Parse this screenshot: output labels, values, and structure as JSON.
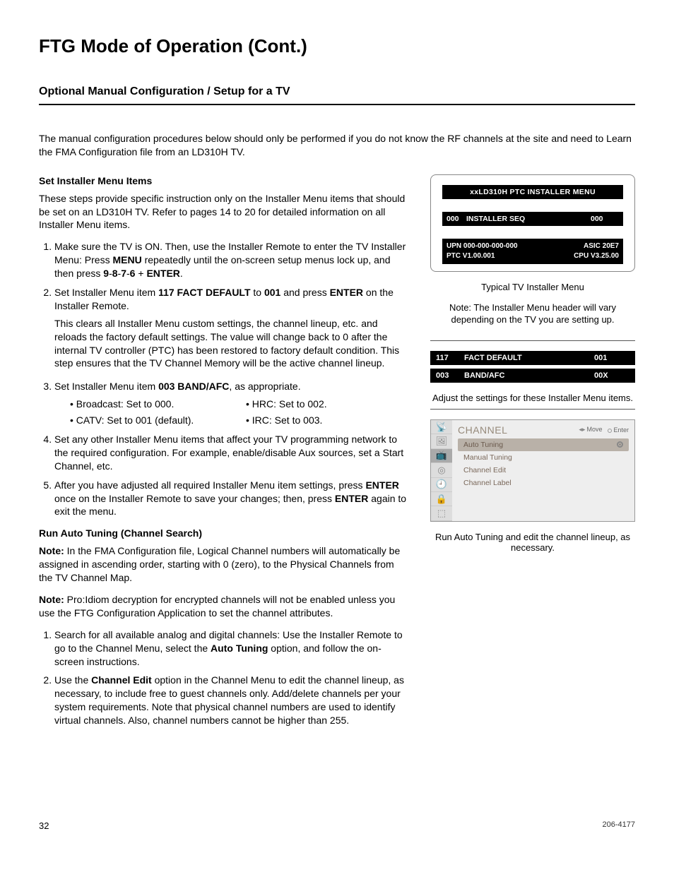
{
  "title": "FTG Mode of Operation (Cont.)",
  "section": "Optional Manual Configuration / Setup for a TV",
  "intro": "The manual configuration procedures below should only be performed if you do not know the RF channels at the site and need to Learn the FMA Configuration file from an LD310H TV.",
  "set_head": "Set Installer Menu Items",
  "set_para": "These steps provide speciﬁc instruction only on the Installer Menu items that should be set on an LD310H TV. Refer to pages 14 to 20 for detailed information on all Installer Menu items.",
  "steps1": {
    "s1a": "Make sure the TV is ON. Then, use the Installer Remote to enter the TV Installer Menu: Press ",
    "s1b": "MENU",
    "s1c": " repeatedly until the on-screen setup menus lock up, and then press ",
    "s1d": "9",
    "dash": "-",
    "s1e": "8",
    "s1f": "7",
    "s1g": "6",
    "plus": " + ",
    "s1h": "ENTER",
    "s1i": ".",
    "s2a": "Set Installer Menu item ",
    "s2b": "117 FACT DEFAULT",
    "s2c": " to ",
    "s2d": "001",
    "s2e": " and press ",
    "s2f": "ENTER",
    "s2g": " on the Installer Remote.",
    "s2p": "This clears all Installer Menu custom settings, the channel lineup, etc. and reloads the factory default settings. The value will change back to 0 after the internal TV controller (PTC) has been restored to factory default condition. This step ensures that the TV Channel Memory will be the active channel lineup.",
    "s3a": "Set Installer Menu item ",
    "s3b": "003 BAND/AFC",
    "s3c": ", as appropriate.",
    "band": {
      "b1": "Broadcast: Set to 000.",
      "b2": "HRC: Set to 002.",
      "b3": "CATV: Set to 001 (default).",
      "b4": "IRC: Set to 003."
    },
    "s4": "Set any other Installer Menu items that affect your TV programming network to the required conﬁguration. For example, enable/disable Aux sources, set a Start Channel, etc.",
    "s5a": "After you have adjusted all required Installer Menu item settings, press ",
    "s5b": "ENTER",
    "s5c": " once on the Installer Remote to save your changes; then, press ",
    "s5d": "ENTER",
    "s5e": " again to exit the menu."
  },
  "run_head": "Run Auto Tuning (Channel Search)",
  "run_n1a": "Note:",
  "run_n1b": " In the FMA Conﬁguration ﬁle, Logical Channel numbers will automatically be assigned in ascending order, starting with 0 (zero), to the Physical Channels from the TV Channel Map.",
  "run_n2a": "Note:",
  "run_n2b": " Pro:Idiom decryption for encrypted channels will not be enabled unless you use the FTG Conﬁguration Application to set the channel attributes.",
  "steps2": {
    "s1a": "Search for all available analog and digital channels: Use the Installer Remote to go to the Channel Menu, select the ",
    "s1b": "Auto Tuning",
    "s1c": " option, and follow the on-screen instructions.",
    "s2a": "Use the ",
    "s2b": "Channel Edit",
    "s2c": " option in the Channel Menu to edit the channel lineup, as necessary, to include free to guest channels only. Add/delete channels per your system requirements. Note that physical channel numbers are used to identify virtual channels. Also, channel numbers cannot be higher than 255."
  },
  "panel": {
    "hdr": "xxLD310H  PTC  INSTALLER  MENU",
    "row_code": "000",
    "row_label": "INSTALLER SEQ",
    "row_val": "000",
    "upn": "UPN  000-000-000-000",
    "ptc": "PTC  V1.00.001",
    "asic": "ASIC  20E7",
    "cpu": "CPU  V3.25.00"
  },
  "cap1": "Typical TV Installer Menu",
  "note_r": "Note: The Installer Menu header will vary depending on the TV you are setting up.",
  "bars": {
    "b1c": "117",
    "b1l": "FACT DEFAULT",
    "b1v": "001",
    "b2c": "003",
    "b2l": "BAND/AFC",
    "b2v": "00X"
  },
  "cap2": "Adjust the settings for these Installer Menu items.",
  "ch": {
    "title": "CHANNEL",
    "move": "Move",
    "enter": "Enter",
    "items": [
      "Auto Tuning",
      "Manual Tuning",
      "Channel Edit",
      "Channel Label"
    ]
  },
  "cap3": "Run Auto Tuning and edit the channel lineup, as necessary.",
  "page": "32",
  "docnum": "206-4177"
}
